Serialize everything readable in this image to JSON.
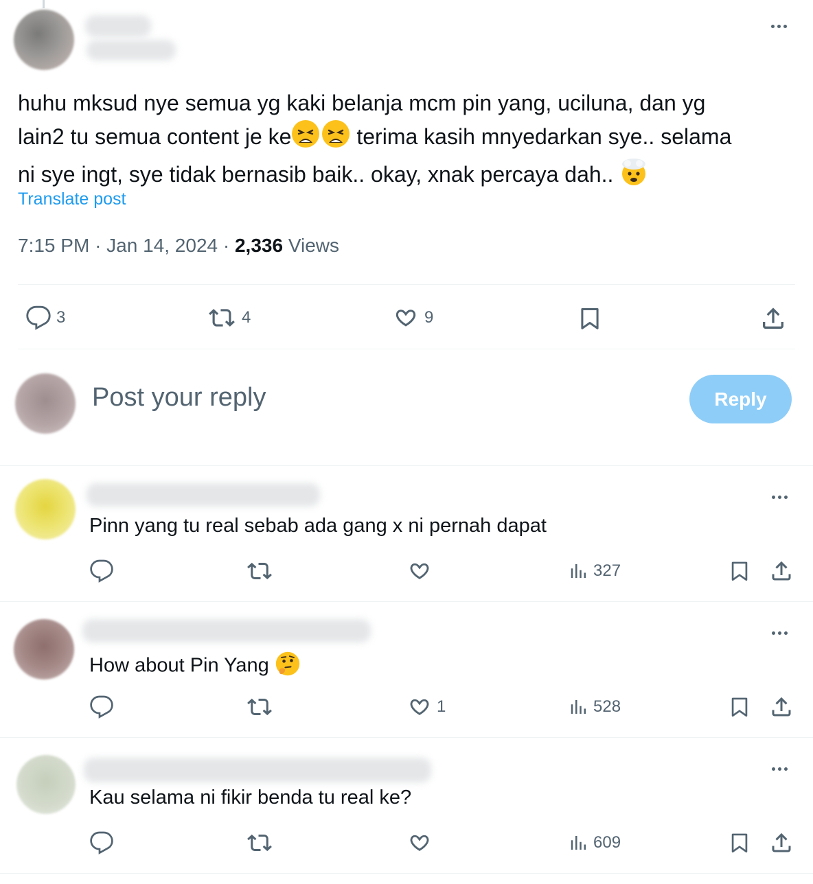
{
  "post": {
    "text_line1": "huhu mksud nye semua yg kaki belanja mcm pin yang, uciluna, dan yg",
    "text_line2_a": "lain2 tu semua content je ke",
    "text_line2_b": " terima kasih mnyedarkan sye.. selama",
    "text_line3": "ni sye ingt, sye tidak bernasib baik.. okay, xnak percaya dah.. ",
    "emojis": [
      "weary-face",
      "weary-face",
      "exploding-head"
    ],
    "translate_label": "Translate post",
    "time": "7:15 PM",
    "date": "Jan 14, 2024",
    "views_count": "2,336",
    "views_label": "Views",
    "stats": {
      "replies": "3",
      "reposts": "4",
      "likes": "9"
    }
  },
  "composer": {
    "placeholder": "Post your reply",
    "button_label": "Reply"
  },
  "replies": [
    {
      "text": "Pinn yang tu real sebab ada gang x ni pernah dapat",
      "likes": "",
      "views": "327"
    },
    {
      "text": "How about Pin Yang ",
      "emoji": "thinking-face",
      "likes": "1",
      "views": "528"
    },
    {
      "text": "Kau selama ni fikir benda tu real ke?",
      "likes": "",
      "views": "609"
    }
  ],
  "colors": {
    "accent": "#1d9bf0",
    "reply_button": "#8ecdf8",
    "muted": "#536471",
    "divider": "#eff3f4"
  }
}
